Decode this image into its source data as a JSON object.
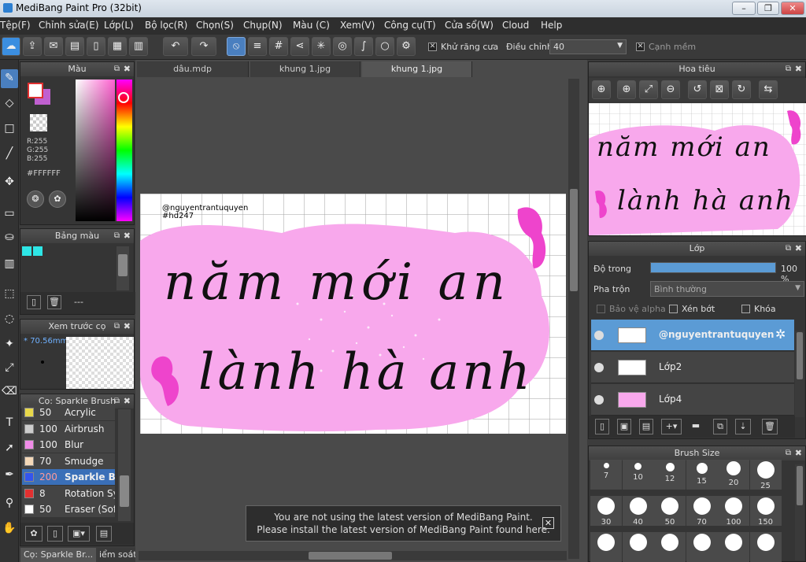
{
  "app": {
    "title": "MediBang Paint Pro (32bit)"
  },
  "menu": [
    "Tệp(F)",
    "Chỉnh sửa(E)",
    "Lớp(L)",
    "Bộ lọc(R)",
    "Chọn(S)",
    "Chụp(N)",
    "Màu (C)",
    "Xem(V)",
    "Công cụ(T)",
    "Cửa sổ(W)",
    "Cloud",
    "Help"
  ],
  "toolbar": {
    "antialias_label": "Khử răng cưa",
    "adjust_label": "Điều chỉnh",
    "adjust_value": "40",
    "soft_edge_label": "Cạnh mềm"
  },
  "color_panel": {
    "title": "Màu",
    "r": "R:255",
    "g": "G:255",
    "b": "B:255",
    "hex": "#FFFFFF",
    "foreground": "#ffffff",
    "background": "#c060d0"
  },
  "palette_panel": {
    "title": "Bảng màu",
    "swatches": [
      "#2ee6e6",
      "#2ee6e6"
    ],
    "dash": "---"
  },
  "preview_panel": {
    "title": "Xem trước cọ",
    "size": "70.56mm"
  },
  "brush_panel": {
    "title": "Cọ: Sparkle Brush",
    "items": [
      {
        "size": "50",
        "name": "Acrylic",
        "color": "#e8d84a"
      },
      {
        "size": "100",
        "name": "Airbrush",
        "color": "#cccccc"
      },
      {
        "size": "100",
        "name": "Blur",
        "color": "#f08ce8"
      },
      {
        "size": "70",
        "name": "Smudge",
        "color": "#f4d8b8"
      },
      {
        "size": "200",
        "name": "Sparkle Br",
        "color": "#3355ee"
      },
      {
        "size": "8",
        "name": "Rotation Sy",
        "color": "#e23030"
      },
      {
        "size": "50",
        "name": "Eraser (Soft",
        "color": "#ffffff"
      }
    ],
    "bottom_tabs": [
      "Cọ: Sparkle Br...",
      "iểm soát ."
    ]
  },
  "tabs": [
    "dâu.mdp",
    "khung 1.jpg",
    "khung 1.jpg"
  ],
  "artwork": {
    "credit": "@nguyentrantuquyen",
    "tag": "#hd247",
    "line1": "năm mới an",
    "line2": "lành hà anh"
  },
  "navigator": {
    "title": "Hoa tiêu"
  },
  "layer_panel": {
    "title": "Lớp",
    "opacity_label": "Độ trong",
    "opacity_value": "100 %",
    "opacity": 1.0,
    "blend_label": "Pha trộn",
    "blend_value": "Bình thường",
    "protect_alpha": "Bảo vệ alpha",
    "clipping": "Xén bớt",
    "lock": "Khóa",
    "layers": [
      {
        "name": "@nguyentrantuquyen",
        "selected": true
      },
      {
        "name": "Lớp2",
        "selected": false
      },
      {
        "name": "Lớp4",
        "selected": false
      }
    ]
  },
  "brush_size_panel": {
    "title": "Brush Size",
    "sizes": [
      "7",
      "10",
      "12",
      "15",
      "20",
      "25",
      "30",
      "40",
      "50",
      "70",
      "100",
      "150",
      "",
      "",
      "",
      "",
      "",
      ""
    ]
  },
  "notice": {
    "line1": "You are not using the latest version of MediBang Paint.",
    "line2": "Please install the latest version of MediBang Paint found here."
  }
}
